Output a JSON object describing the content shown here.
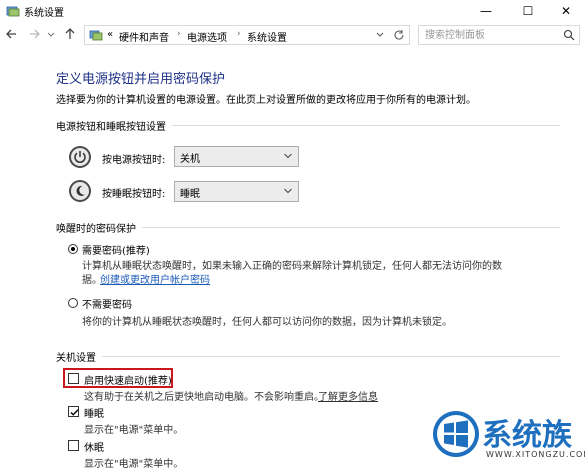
{
  "window": {
    "title": "系统设置",
    "minimize": "—",
    "maximize": "☐",
    "close": "✕"
  },
  "address": {
    "overflow": "«",
    "crumbs": [
      "硬件和声音",
      "电源选项",
      "系统设置"
    ],
    "search_placeholder": "搜索控制面板"
  },
  "main": {
    "title": "定义电源按钮并启用密码保护",
    "description": "选择要为你的计算机设置的电源设置。在此页上对设置所做的更改将应用于你所有的电源计划。"
  },
  "power_buttons": {
    "heading": "电源按钮和睡眠按钮设置",
    "power_label": "按电源按钮时:",
    "power_value": "关机",
    "sleep_label": "按睡眠按钮时:",
    "sleep_value": "睡眠"
  },
  "password": {
    "heading": "唤醒时的密码保护",
    "require_label": "需要密码(推荐)",
    "require_desc1": "计算机从睡眠状态唤醒时，如果未输入正确的密码来解除计算机锁定，任何人都无法访问你的数",
    "require_desc2": "据。",
    "require_link": "创建或更改用户帐户密码",
    "norequire_label": "不需要密码",
    "norequire_desc": "将你的计算机从睡眠状态唤醒时，任何人都可以访问你的数据，因为计算机未锁定。"
  },
  "shutdown": {
    "heading": "关机设置",
    "fast_label": "启用快速启动(推荐)",
    "fast_desc": "这有助于在关机之后更快地启动电脑。不会影响重启。",
    "fast_link": "了解更多信息",
    "sleep_label": "睡眠",
    "sleep_desc": "显示在\"电源\"菜单中。",
    "hibernate_label": "休眠",
    "hibernate_desc": "显示在\"电源\"菜单中。"
  },
  "watermark": {
    "text": "系统族",
    "sub": "WWW.XITONGZU.COM"
  },
  "colors": {
    "title_blue": "#1e3287",
    "link_blue": "#1a5bb8",
    "highlight_red": "#c8171e"
  }
}
